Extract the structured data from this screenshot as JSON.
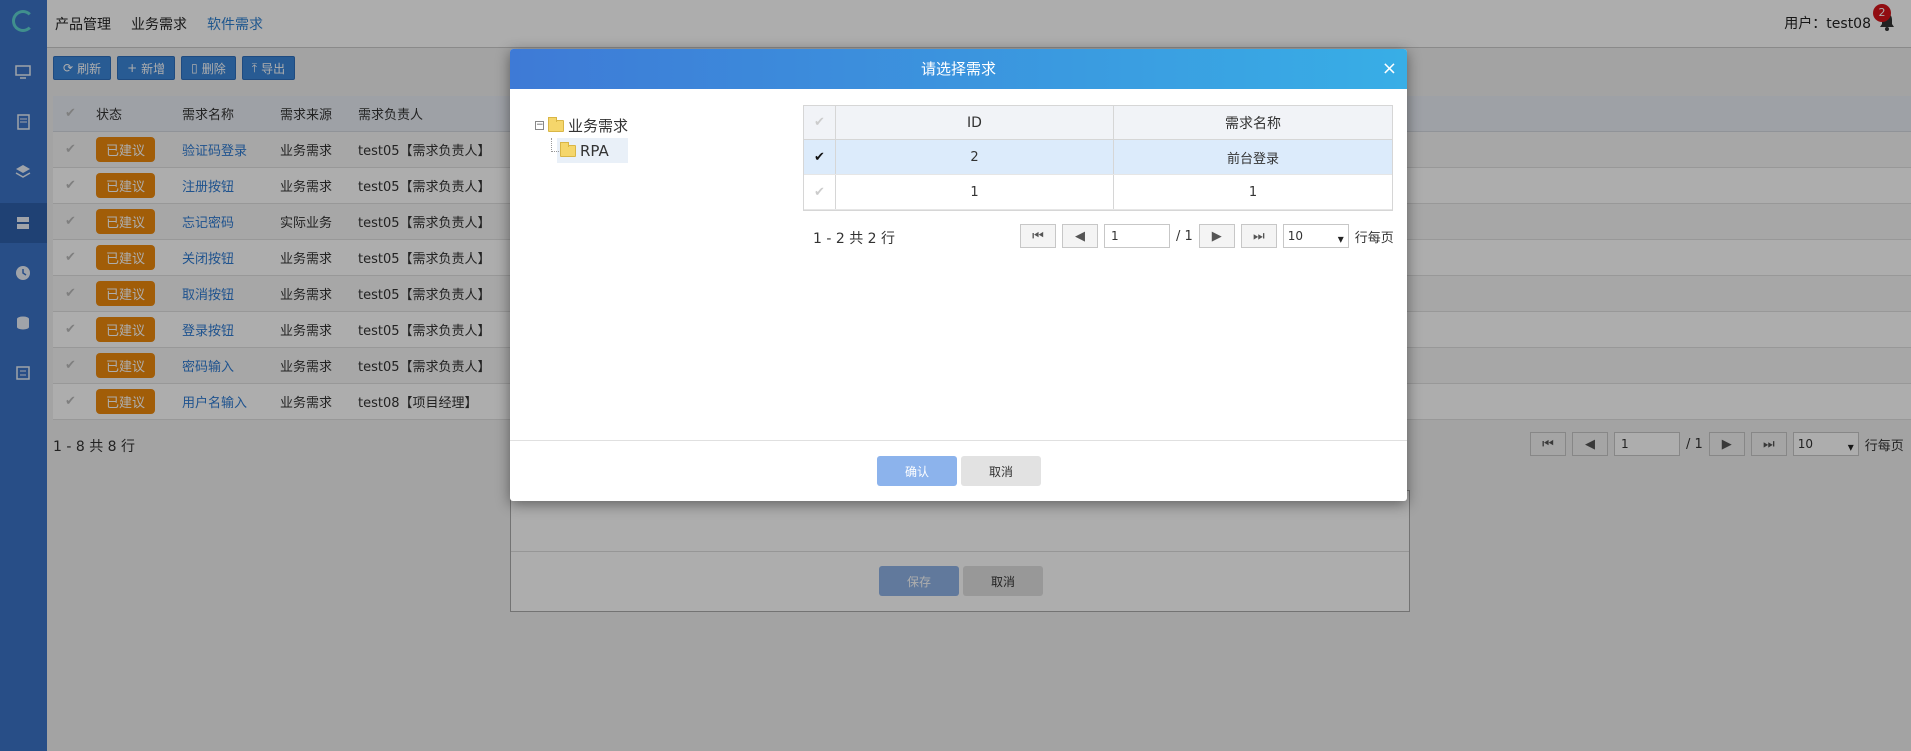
{
  "topnav": {
    "items": [
      {
        "label": "产品管理"
      },
      {
        "label": "业务需求"
      },
      {
        "label": "软件需求"
      }
    ],
    "user": "用户：test08",
    "notification_count": "2"
  },
  "toolbar": {
    "refresh": "刷新",
    "add": "新增",
    "delete": "删除",
    "export": "导出"
  },
  "table": {
    "headers": [
      "状态",
      "需求名称",
      "需求来源",
      "需求负责人"
    ],
    "rows": [
      {
        "status": "已建议",
        "name": "验证码登录",
        "source": "业务需求",
        "owner": "test05【需求负责人】"
      },
      {
        "status": "已建议",
        "name": "注册按钮",
        "source": "业务需求",
        "owner": "test05【需求负责人】"
      },
      {
        "status": "已建议",
        "name": "忘记密码",
        "source": "实际业务",
        "owner": "test05【需求负责人】"
      },
      {
        "status": "已建议",
        "name": "关闭按钮",
        "source": "业务需求",
        "owner": "test05【需求负责人】"
      },
      {
        "status": "已建议",
        "name": "取消按钮",
        "source": "业务需求",
        "owner": "test05【需求负责人】"
      },
      {
        "status": "已建议",
        "name": "登录按钮",
        "source": "业务需求",
        "owner": "test05【需求负责人】"
      },
      {
        "status": "已建议",
        "name": "密码输入",
        "source": "业务需求",
        "owner": "test05【需求负责人】"
      },
      {
        "status": "已建议",
        "name": "用户名输入",
        "source": "业务需求",
        "owner": "test08【项目经理】"
      }
    ],
    "footer": "1 - 8 共 8 行",
    "pager": {
      "page": "1",
      "total": "/ 1",
      "per_page": "10",
      "per_page_label": "行每页"
    }
  },
  "bg_dialog": {
    "save": "保存",
    "cancel": "取消"
  },
  "modal": {
    "title": "请选择需求",
    "close": "×",
    "tree": {
      "root": "业务需求",
      "child": "RPA"
    },
    "grid": {
      "headers": [
        "ID",
        "需求名称"
      ],
      "rows": [
        {
          "id": "2",
          "name": "前台登录",
          "selected": true
        },
        {
          "id": "1",
          "name": "1",
          "selected": false
        }
      ]
    },
    "footer": "1 - 2 共 2 行",
    "pager": {
      "page": "1",
      "total": "/ 1",
      "per_page": "10",
      "per_page_label": "行每页"
    },
    "confirm": "确认",
    "cancel": "取消"
  }
}
